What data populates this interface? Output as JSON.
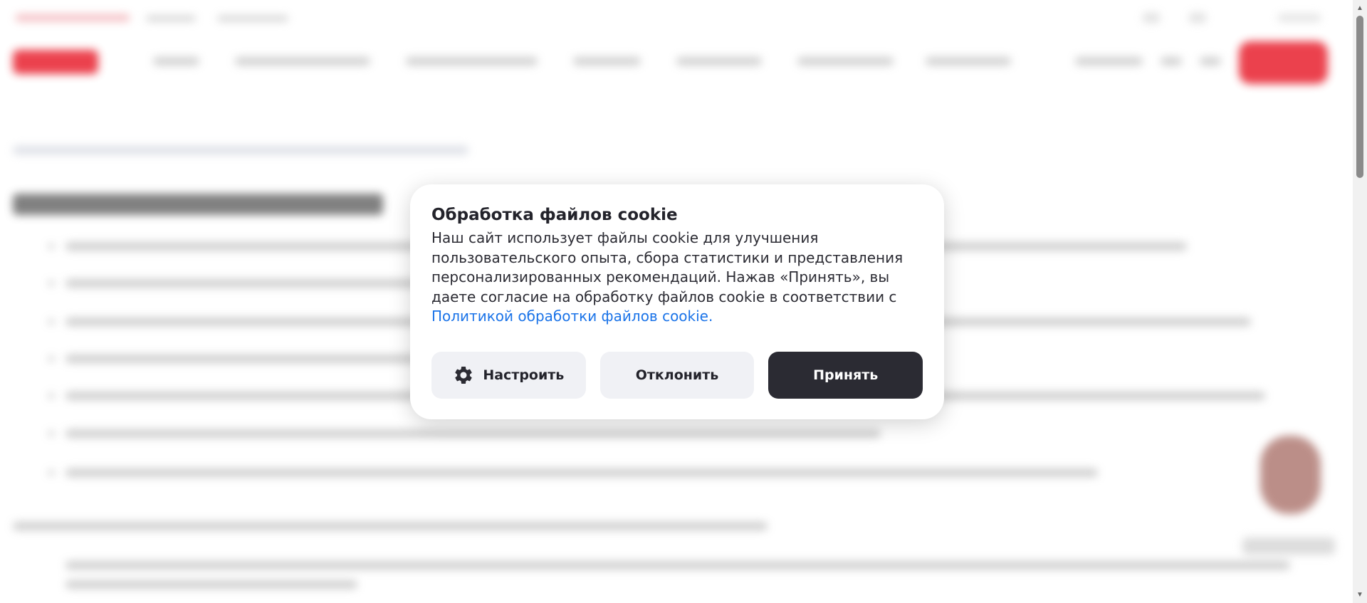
{
  "cookie_dialog": {
    "title": "Обработка файлов cookie",
    "text": "Наш сайт использует файлы cookie для улучшения пользовательского опыта, сбора статистики и представления персонализированных рекомендаций. Нажав «Принять», вы даете согласие на обработку файлов cookie в соответствии с ",
    "link_text": "Политикой обработки файлов cookie.",
    "buttons": {
      "settings": "Настроить",
      "reject": "Отклонить",
      "accept": "Принять"
    },
    "icons": {
      "settings": "gear-icon"
    }
  },
  "colors": {
    "brand_red": "#e8202e",
    "link_blue": "#1a73e8",
    "accept_dark": "#2b2b33",
    "secondary_button": "#f0f1f5"
  }
}
